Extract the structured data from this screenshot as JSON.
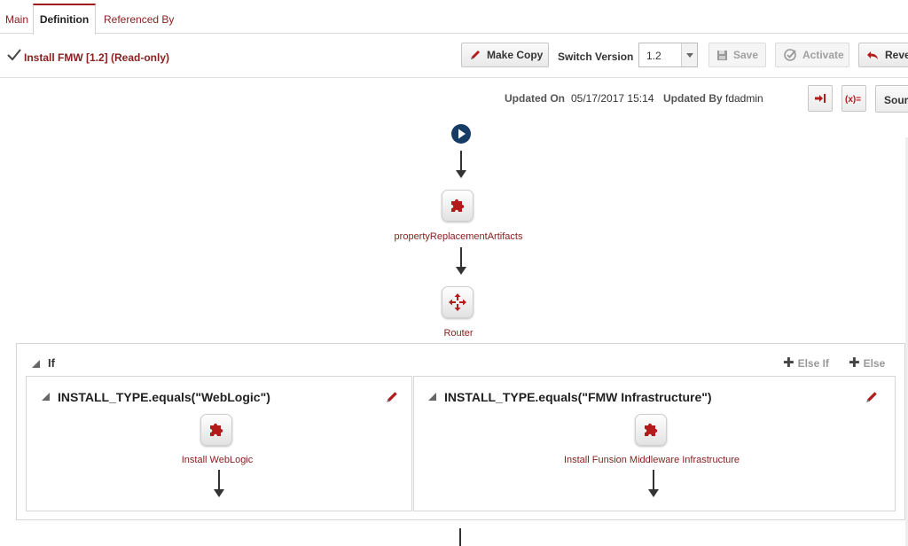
{
  "tabs": [
    {
      "label": "Main",
      "active": false
    },
    {
      "label": "Definition",
      "active": true
    },
    {
      "label": "Referenced By",
      "active": false
    }
  ],
  "header": {
    "title": "Install FMW [1.2] (Read-only)",
    "make_copy": "Make Copy",
    "switch_version_label": "Switch Version",
    "version_value": "1.2",
    "save": "Save",
    "activate": "Activate",
    "revert": "Reve"
  },
  "meta": {
    "updated_on_label": "Updated On",
    "updated_on_value": "05/17/2017 15:14",
    "updated_by_label": "Updated By",
    "updated_by_value": "fdadmin",
    "source_button": "Sour"
  },
  "flow": {
    "nodes": [
      {
        "label": "propertyReplacementArtifacts",
        "icon": "puzzle-icon"
      },
      {
        "label": "Router",
        "icon": "router-icon"
      }
    ],
    "if_block": {
      "title": "If",
      "else_if": "Else If",
      "else": "Else",
      "branches": [
        {
          "condition": "INSTALL_TYPE.equals(\"WebLogic\")",
          "node_label": "Install WebLogic"
        },
        {
          "condition": "INSTALL_TYPE.equals(\"FMW Infrastructure\")",
          "node_label": "Install Funsion Middleware Infrastructure"
        }
      ]
    }
  },
  "colors": {
    "brand_red": "#9e1b1b",
    "label_red": "#8a2020",
    "start_blue": "#163c66"
  }
}
